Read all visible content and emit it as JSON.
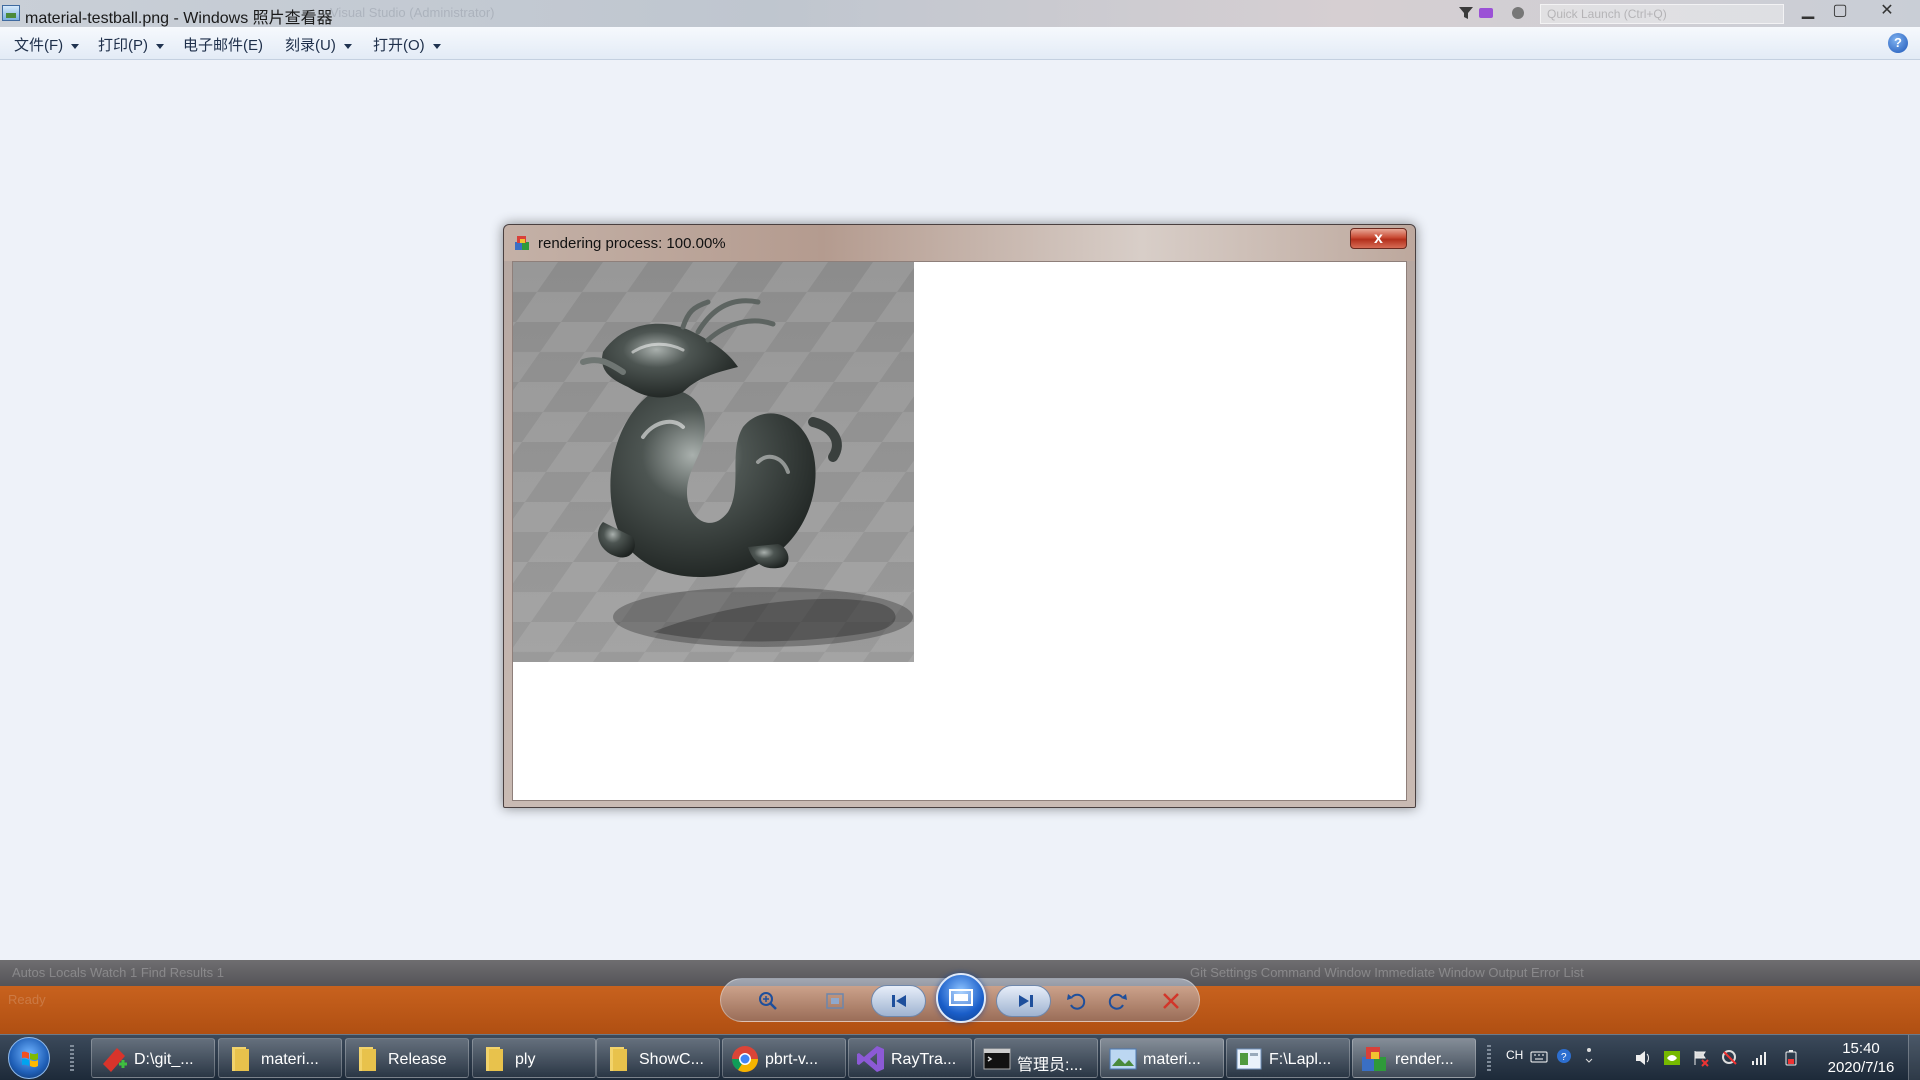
{
  "window": {
    "title": "material-testball.png - Windows 照片查看器",
    "faint_title": "Visual Studio (Administrator)",
    "quick_launch": "Quick Launch (Ctrl+Q)"
  },
  "menu": [
    {
      "label": "文件(F)",
      "dropdown": true
    },
    {
      "label": "打印(P)",
      "dropdown": true
    },
    {
      "label": "电子邮件(E)",
      "dropdown": false
    },
    {
      "label": "刻录(U)",
      "dropdown": true
    },
    {
      "label": "打开(O)",
      "dropdown": true
    }
  ],
  "render_window": {
    "title": "rendering process: 100.00%",
    "close": "x",
    "image_alt": "rendered dragon"
  },
  "ide": {
    "left_tabs": "Autos  Locals  Watch 1  Find Results 1",
    "right_tabs": "Git Settings  Command Window  Immediate Window  Output  Error List",
    "status": "Ready"
  },
  "viewer_toolbar": {
    "buttons": [
      "zoom-icon",
      "fit-icon",
      "previous-icon",
      "slideshow-icon",
      "next-icon",
      "rotate-ccw-icon",
      "rotate-cw-icon",
      "delete-icon"
    ]
  },
  "taskbar": {
    "items": [
      {
        "label": "D:\\git_...",
        "icon": "git-icon"
      },
      {
        "label": "materi...",
        "icon": "folder-icon"
      },
      {
        "label": "Release",
        "icon": "folder-icon"
      },
      {
        "label": "ply",
        "icon": "folder-icon"
      },
      {
        "label": "ShowC...",
        "icon": "folder-icon"
      },
      {
        "label": "pbrt-v...",
        "icon": "chrome-icon"
      },
      {
        "label": "RayTra...",
        "icon": "visual-studio-icon"
      },
      {
        "label": "管理员:...",
        "icon": "cmd-icon"
      },
      {
        "label": "materi...",
        "icon": "photo-viewer-icon"
      },
      {
        "label": "F:\\Lapl...",
        "icon": "explorer-window-icon"
      },
      {
        "label": "render...",
        "icon": "app-icon"
      }
    ],
    "ime": "CH",
    "time": "15:40",
    "date": "2020/7/16"
  },
  "colors": {
    "viewer_bg": "#eef2f9",
    "taskbar": "#1d2a39",
    "close_red": "#c84a33",
    "ide_orange": "#c8621e"
  }
}
